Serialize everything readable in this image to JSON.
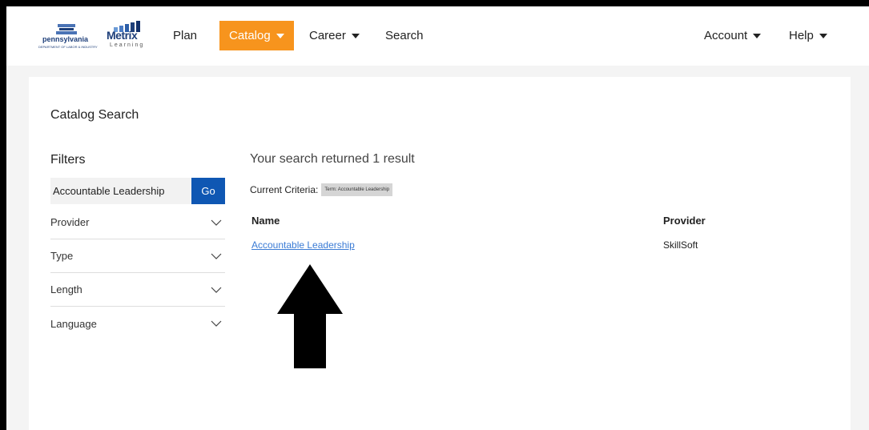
{
  "header": {
    "logo_pa_text": "pennsylvania",
    "logo_pa_subtext": "DEPARTMENT OF LABOR & INDUSTRY",
    "logo_metrix_text": "Metrix",
    "logo_metrix_subtext": "Learning",
    "nav": [
      {
        "label": "Plan"
      },
      {
        "label": "Catalog"
      },
      {
        "label": "Career"
      },
      {
        "label": "Search"
      }
    ],
    "right_nav": [
      {
        "label": "Account"
      },
      {
        "label": "Help"
      }
    ],
    "active_color": "#f7941d"
  },
  "page": {
    "title": "Catalog Search"
  },
  "filters": {
    "title": "Filters",
    "search_value": "Accountable Leadership",
    "go_label": "Go",
    "items": [
      {
        "label": "Provider"
      },
      {
        "label": "Type"
      },
      {
        "label": "Length"
      },
      {
        "label": "Language"
      }
    ]
  },
  "results": {
    "summary": "Your search returned 1 result",
    "criteria_label": "Current Criteria:",
    "criteria_tag": "Term: Accountable Leadership",
    "columns": {
      "name": "Name",
      "provider": "Provider"
    },
    "rows": [
      {
        "name": "Accountable Leadership",
        "provider": "SkillSoft"
      }
    ]
  },
  "colors": {
    "go_button": "#0f57b3",
    "link": "#3a7bd5"
  }
}
